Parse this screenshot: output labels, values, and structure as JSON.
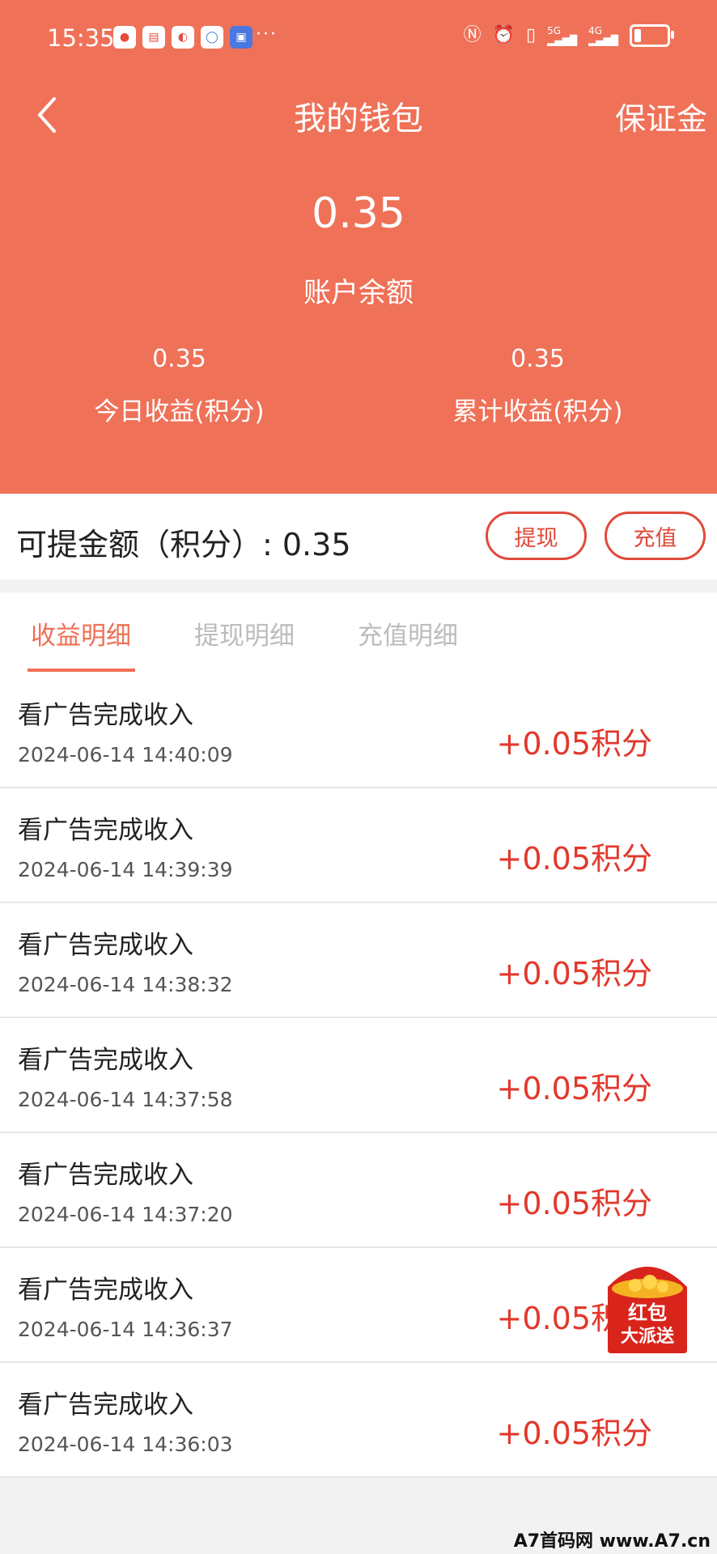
{
  "status_bar": {
    "time": "15:35",
    "more": "···",
    "signal_5g": "5G",
    "signal_4g": "4G"
  },
  "nav": {
    "title": "我的钱包",
    "right_label": "保证金",
    "back_icon": "chevron-left-icon"
  },
  "summary": {
    "balance": "0.35",
    "balance_label": "账户余额",
    "today_value": "0.35",
    "today_label": "今日收益(积分)",
    "total_value": "0.35",
    "total_label": "累计收益(积分)"
  },
  "withdraw": {
    "text": "可提金额（积分）: 0.35",
    "withdraw_button": "提现",
    "recharge_button": "充值"
  },
  "tabs": [
    {
      "label": "收益明细",
      "active": true
    },
    {
      "label": "提现明细",
      "active": false
    },
    {
      "label": "充值明细",
      "active": false
    }
  ],
  "records": [
    {
      "title": "看广告完成收入",
      "time": "2024-06-14 14:40:09",
      "amount": "+0.05积分"
    },
    {
      "title": "看广告完成收入",
      "time": "2024-06-14 14:39:39",
      "amount": "+0.05积分"
    },
    {
      "title": "看广告完成收入",
      "time": "2024-06-14 14:38:32",
      "amount": "+0.05积分"
    },
    {
      "title": "看广告完成收入",
      "time": "2024-06-14 14:37:58",
      "amount": "+0.05积分"
    },
    {
      "title": "看广告完成收入",
      "time": "2024-06-14 14:37:20",
      "amount": "+0.05积分"
    },
    {
      "title": "看广告完成收入",
      "time": "2024-06-14 14:36:37",
      "amount": "+0.05积分"
    },
    {
      "title": "看广告完成收入",
      "time": "2024-06-14 14:36:03",
      "amount": "+0.05积分"
    }
  ],
  "red_packet": {
    "line1": "红包",
    "line2": "大派送"
  },
  "watermark": "A7首码网 www.A7.cn",
  "colors": {
    "header_bg": "#ef7158",
    "accent_red": "#e2382b",
    "tab_active": "#ef6f55"
  }
}
